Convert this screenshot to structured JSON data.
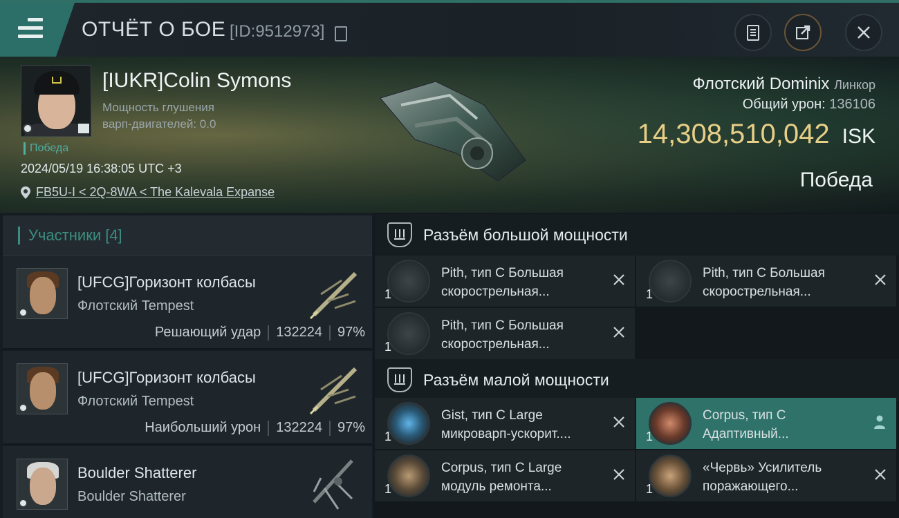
{
  "header": {
    "title": "ОТЧЁТ О БОЕ",
    "id_label": "[ID:9512973]"
  },
  "hero": {
    "pilot_name": "[IUKR]Colin Symons",
    "pilot_stat_line1": "Мощность глушения",
    "pilot_stat_line2": "варп-двигателей: 0.0",
    "result_tag": "Победа",
    "datetime": "2024/05/19 16:38:05 UTC +3",
    "location": "FB5U-I < 2Q-8WA < The Kalevala Expanse",
    "ship_name": "Флотский Dominix",
    "ship_class": "Линкор",
    "damage_label": "Общий урон:",
    "damage_value": "136106",
    "isk_value": "14,308,510,042",
    "isk_unit": "ISK",
    "outcome": "Победа"
  },
  "participants": {
    "header": "Участники [4]",
    "items": [
      {
        "name": "[UFCG]Горизонт колбасы",
        "ship": "Флотский Tempest",
        "role": "Решающий удар",
        "damage": "132224",
        "percent": "97%"
      },
      {
        "name": "[UFCG]Горизонт колбасы",
        "ship": "Флотский Tempest",
        "role": "Наибольший урон",
        "damage": "132224",
        "percent": "97%"
      },
      {
        "name": "Boulder Shatterer",
        "ship": "Boulder Shatterer"
      }
    ]
  },
  "fitting": {
    "high_slot_title": "Разъём большой мощности",
    "low_slot_title": "Разъём малой мощности",
    "high_modules": [
      {
        "line1": "Pith, тип C Большая",
        "line2": "скорострельная...",
        "qty": "1"
      },
      {
        "line1": "Pith, тип C Большая",
        "line2": "скорострельная...",
        "qty": "1"
      },
      {
        "line1": "Pith, тип C Большая",
        "line2": "скорострельная...",
        "qty": "1"
      }
    ],
    "low_modules": [
      {
        "line1": "Gist, тип C Large",
        "line2": "микроварп-ускорит....",
        "qty": "1"
      },
      {
        "line1": "Corpus, тип C",
        "line2": "Адаптивный...",
        "qty": "1"
      },
      {
        "line1": "Corpus, тип C Large",
        "line2": "модуль ремонта...",
        "qty": "1"
      },
      {
        "line1": "«Червь» Усилитель",
        "line2": "поражающего...",
        "qty": "1"
      }
    ]
  },
  "colors": {
    "accent": "#2f7269",
    "isk": "#e8cf87",
    "victory": "#4fae9f"
  },
  "icons": [
    "menu-icon",
    "copy-icon",
    "clipboard-icon",
    "share-icon",
    "close-icon",
    "location-pin-icon",
    "high-slot-icon",
    "low-slot-icon",
    "remove-icon",
    "person-icon"
  ]
}
